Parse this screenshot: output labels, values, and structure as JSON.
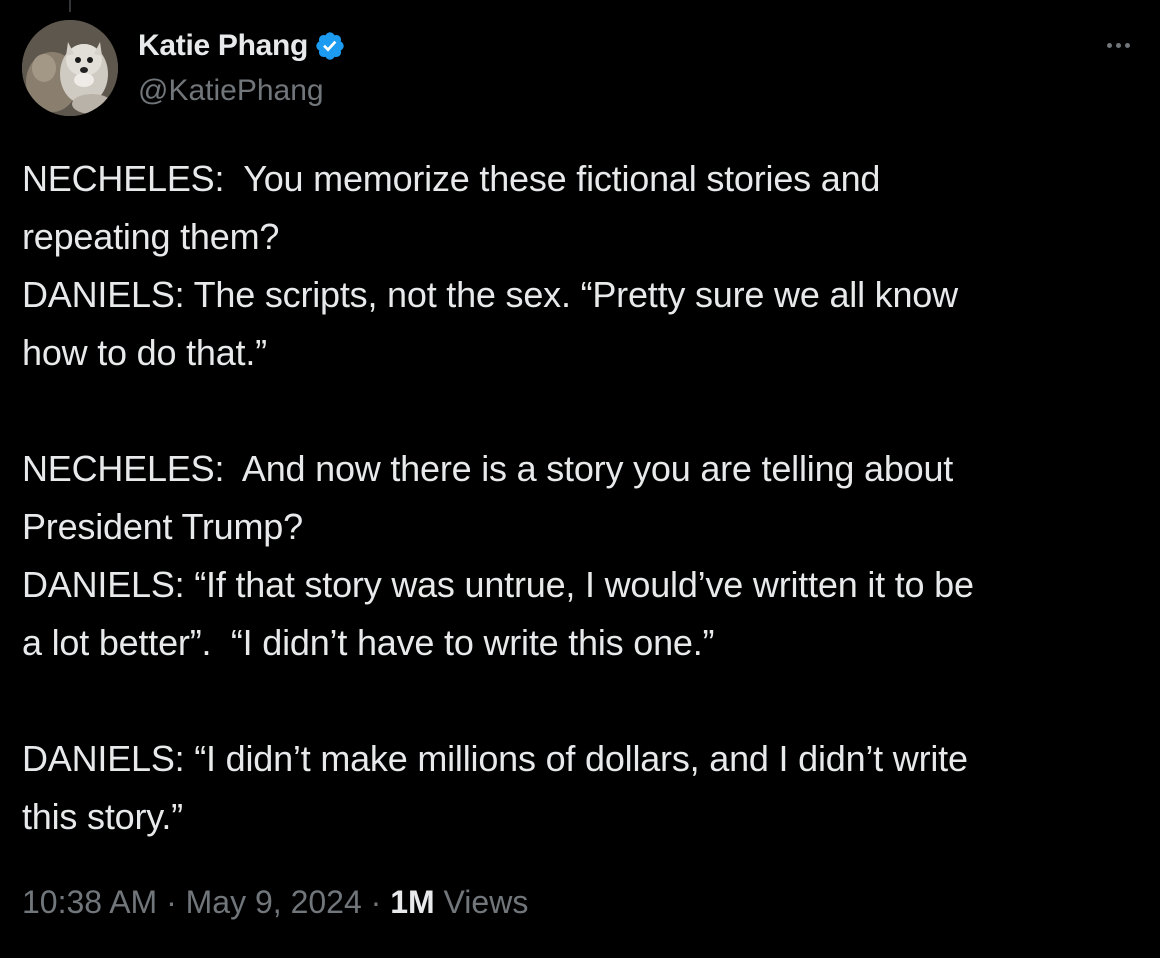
{
  "author": {
    "display_name": "Katie Phang",
    "handle": "@KatiePhang",
    "verified": true,
    "verified_color": "#1d9bf0"
  },
  "more_icon": "more-horizontal-icon",
  "tweet": {
    "lines": [
      "NECHELES:  You memorize these fictional stories and",
      "repeating them?",
      "DANIELS: The scripts, not the sex. “Pretty sure we all know",
      "how to do that.”",
      "",
      "NECHELES:  And now there is a story you are telling about",
      "President Trump?",
      "DANIELS: “If that story was untrue, I would’ve written it to be",
      "a lot better”.  “I didn’t have to write this one.”",
      "",
      "DANIELS: “I didn’t make millions of dollars, and I didn’t write",
      "this story.”"
    ]
  },
  "meta": {
    "time": "10:38 AM",
    "separator": " · ",
    "date": "May 9, 2024",
    "views_count": "1M",
    "views_label": " Views"
  },
  "colors": {
    "background": "#000000",
    "text": "#e7e9ea",
    "secondary": "#71767b"
  }
}
